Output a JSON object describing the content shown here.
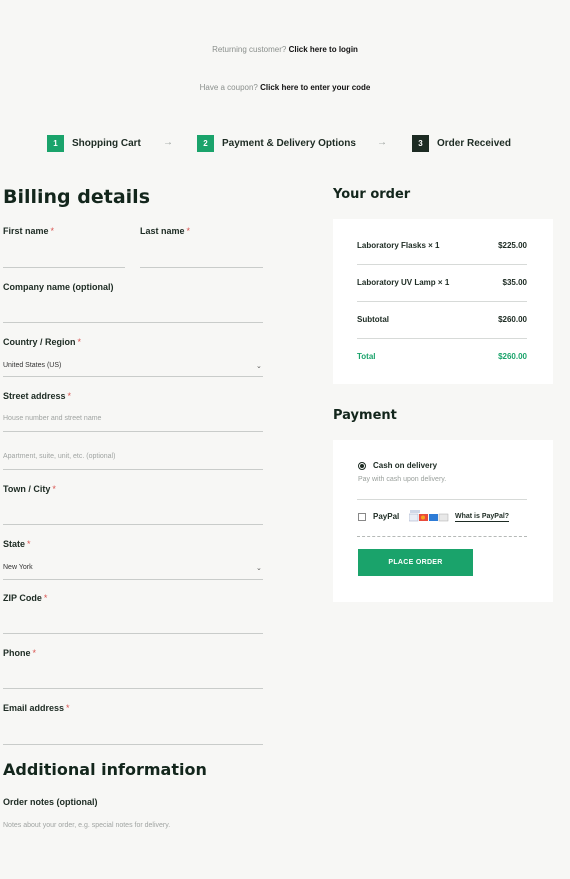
{
  "notices": {
    "returning_text": "Returning customer?",
    "returning_link": "Click here to login",
    "coupon_text": "Have a coupon?",
    "coupon_link": "Click here to enter your code"
  },
  "steps": [
    {
      "num": "1",
      "label": "Shopping Cart"
    },
    {
      "num": "2",
      "label": "Payment & Delivery Options"
    },
    {
      "num": "3",
      "label": "Order Received"
    }
  ],
  "billing": {
    "title": "Billing details",
    "first_name": "First name",
    "last_name": "Last name",
    "company": "Company name (optional)",
    "country_label": "Country / Region",
    "country_value": "United States (US)",
    "street_label": "Street address",
    "street_placeholder": "House number and street name",
    "apartment_placeholder": "Apartment, suite, unit, etc. (optional)",
    "town_label": "Town / City",
    "state_label": "State",
    "state_value": "New York",
    "zip_label": "ZIP Code",
    "phone_label": "Phone",
    "email_label": "Email address",
    "required_mark": "*"
  },
  "additional": {
    "title": "Additional information",
    "notes_label": "Order notes (optional)",
    "notes_placeholder": "Notes about your order, e.g. special notes for delivery."
  },
  "order": {
    "title": "Your order",
    "items": [
      {
        "name": "Laboratory Flasks",
        "qty": "× 1",
        "price": "$225.00"
      },
      {
        "name": "Laboratory UV Lamp",
        "qty": "× 1",
        "price": "$35.00"
      }
    ],
    "subtotal_label": "Subtotal",
    "subtotal_value": "$260.00",
    "total_label": "Total",
    "total_value": "$260.00"
  },
  "payment": {
    "title": "Payment",
    "cod_label": "Cash on delivery",
    "cod_desc": "Pay with cash upon delivery.",
    "paypal_label": "PayPal",
    "paypal_link": "What is PayPal?",
    "place_order": "PLACE ORDER"
  },
  "colors": {
    "accent": "#1aa36b",
    "dark": "#1d2b23",
    "required": "#d9534f"
  },
  "icons": {
    "step_arrow": "arrow-right-icon",
    "select_caret": "chevron-down-icon",
    "card_logos": "payment-cards-icon"
  }
}
